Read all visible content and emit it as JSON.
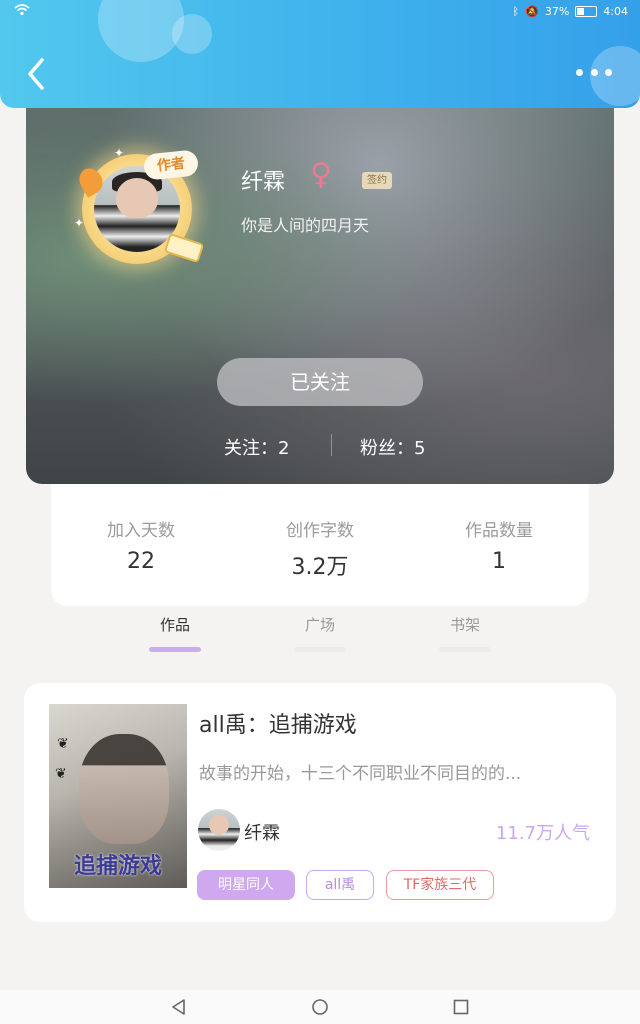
{
  "status_bar": {
    "battery": "37%",
    "time": "4:04"
  },
  "header": {
    "back_icon": "chevron-left-icon",
    "more_icon": "more-horizontal-icon"
  },
  "profile": {
    "name": "纤霖",
    "gender_symbol": "♀",
    "sign_tag": "签约",
    "author_badge": "作者",
    "bio": "你是人间的四月天",
    "follow_button": "已关注",
    "following": "关注：2",
    "followers": "粉丝：5"
  },
  "stats": [
    {
      "label": "加入天数",
      "value": "22"
    },
    {
      "label": "创作字数",
      "value": "3.2万"
    },
    {
      "label": "作品数量",
      "value": "1"
    }
  ],
  "tabs": [
    {
      "label": "作品",
      "active": true
    },
    {
      "label": "广场",
      "active": false
    },
    {
      "label": "书架",
      "active": false
    }
  ],
  "work": {
    "cover_title": "追捕游戏",
    "title": "all禹：追捕游戏",
    "description": "故事的开始，十三个不同职业不同目的的...",
    "author": "纤霖",
    "popularity": "11.7万人气",
    "tags": [
      "明星同人",
      "all禹",
      "TF家族三代"
    ]
  },
  "colors": {
    "accent": "#c8aef0",
    "header": "#3fb2ec",
    "gender": "#e97b97",
    "tag_red": "#e06a6a"
  }
}
